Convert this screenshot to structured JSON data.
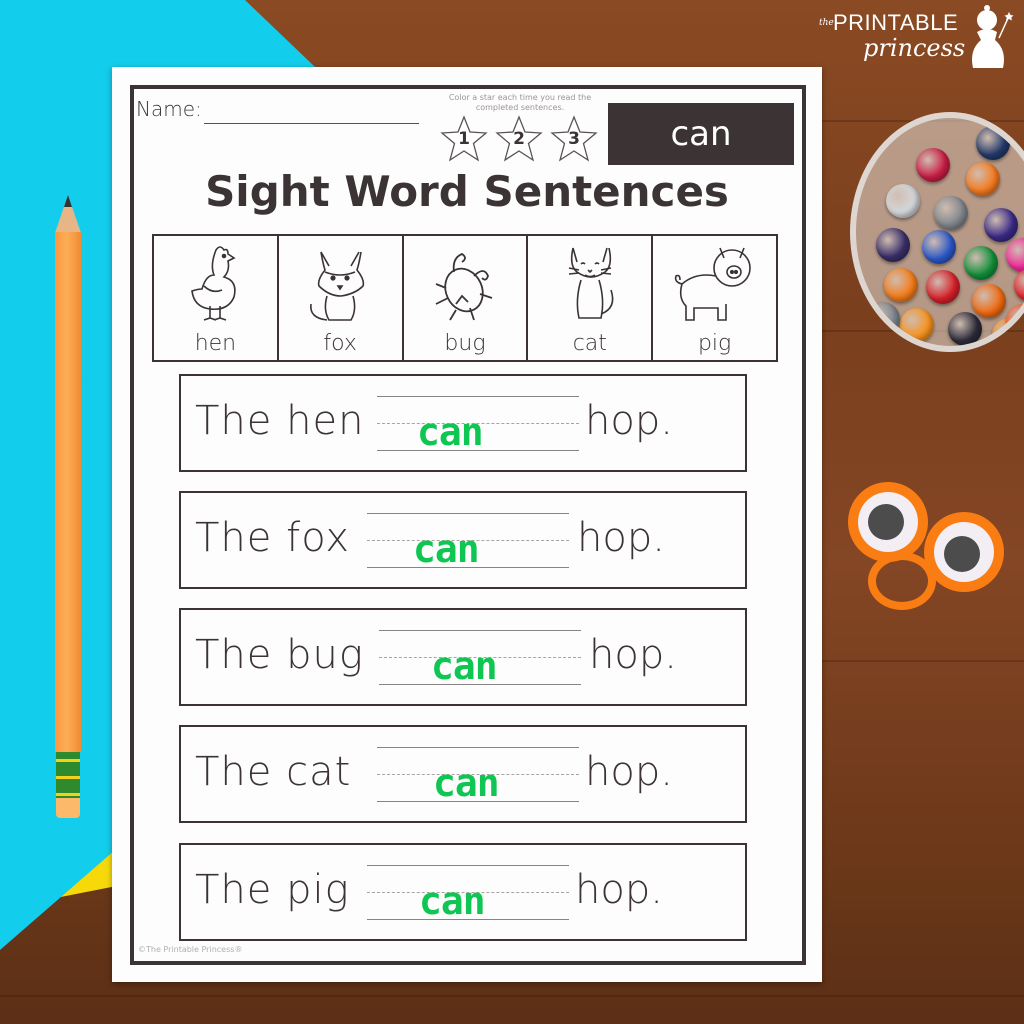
{
  "brand": {
    "logo_prefix": "the",
    "logo_main": "PRINTABLE",
    "logo_script": "princess"
  },
  "worksheet": {
    "name_label": "Name:",
    "star_instructions": "Color a star each time you read the completed sentences.",
    "stars": [
      "1",
      "2",
      "3"
    ],
    "sight_word": "can",
    "title": "Sight Word Sentences",
    "pictures": [
      {
        "word": "hen",
        "icon": "hen-icon"
      },
      {
        "word": "fox",
        "icon": "fox-icon"
      },
      {
        "word": "bug",
        "icon": "bug-icon"
      },
      {
        "word": "cat",
        "icon": "cat-icon"
      },
      {
        "word": "pig",
        "icon": "pig-icon"
      }
    ],
    "sentences": [
      {
        "start": "The hen",
        "answer": "can",
        "end": "hop."
      },
      {
        "start": "The fox",
        "answer": "can",
        "end": "hop."
      },
      {
        "start": "The bug",
        "answer": "can",
        "end": "hop."
      },
      {
        "start": "The cat",
        "answer": "can",
        "end": "hop."
      },
      {
        "start": "The pig",
        "answer": "can",
        "end": "hop."
      }
    ],
    "copyright": "©The Printable Princess®"
  },
  "colors": {
    "answer_green": "#10c653",
    "ink": "#3b3334",
    "blue_paper": "#12cdec",
    "yellow_paper": "#f7d90a",
    "googly_orange": "#f97d13"
  },
  "props": {
    "crayon_colors": [
      "#233a6b",
      "#c81e45",
      "#f47a20",
      "#d3d7db",
      "#80868c",
      "#3a2a88",
      "#3a2f6a",
      "#2b58c9",
      "#13903b",
      "#f22b9a",
      "#f57d1a",
      "#d6202a",
      "#ef6a12",
      "#e5262e",
      "#f7931e",
      "#2b2b3a",
      "#f78a1e",
      "#7e868e",
      "#ec4c1a"
    ]
  }
}
